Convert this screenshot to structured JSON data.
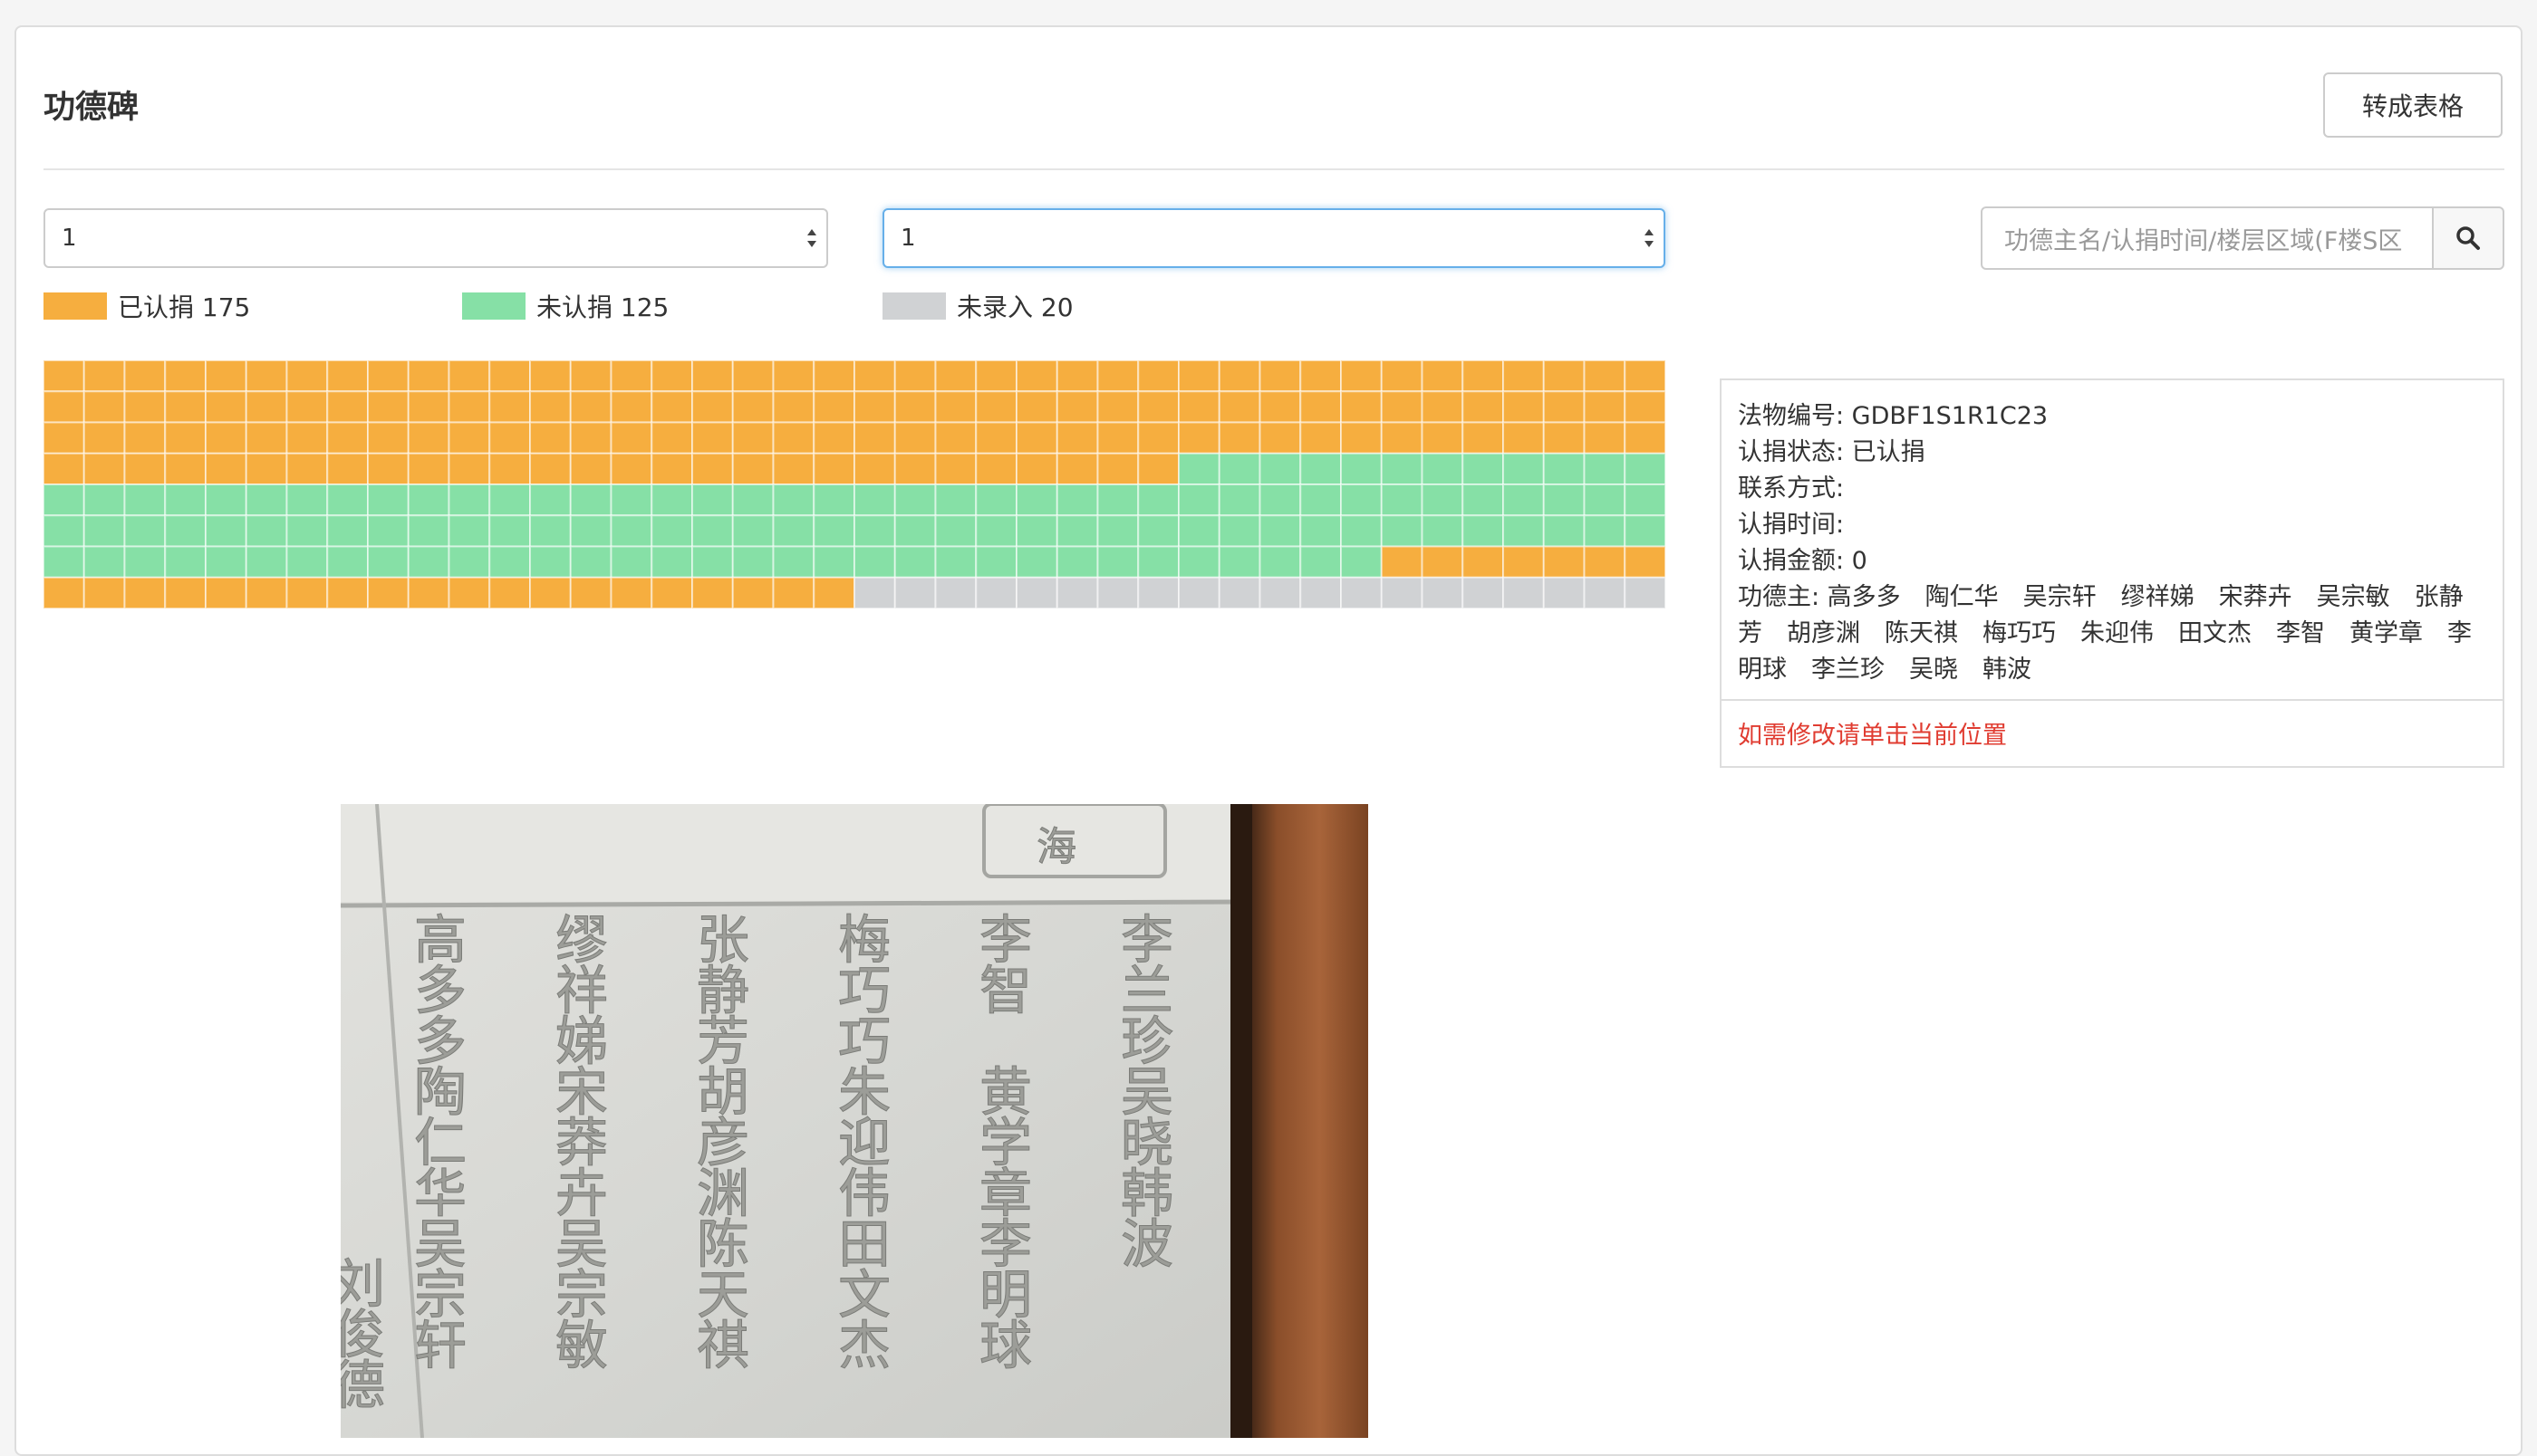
{
  "page": {
    "title": "功德碑",
    "convert_button": "转成表格"
  },
  "filters": {
    "select_one_value": "1",
    "select_two_value": "1",
    "search_placeholder": "功德主名/认捐时间/楼层区域(F楼S区"
  },
  "legend": {
    "donated_label": "已认捐 175",
    "undonated_label": "未认捐 125",
    "unentered_label": "未录入 20"
  },
  "colors": {
    "donated": "#f6ae3f",
    "undonated": "#86e0a6",
    "unentered": "#d0d2d4",
    "link": "#e03c31"
  },
  "grid": {
    "columns": 40,
    "rows": [
      {
        "segments": [
          {
            "status": "donated",
            "count": 40
          }
        ]
      },
      {
        "segments": [
          {
            "status": "donated",
            "count": 40
          }
        ]
      },
      {
        "segments": [
          {
            "status": "donated",
            "count": 40
          }
        ]
      },
      {
        "segments": [
          {
            "status": "donated",
            "count": 28
          },
          {
            "status": "undonated",
            "count": 12
          }
        ]
      },
      {
        "segments": [
          {
            "status": "undonated",
            "count": 40
          }
        ]
      },
      {
        "segments": [
          {
            "status": "undonated",
            "count": 40
          }
        ]
      },
      {
        "segments": [
          {
            "status": "undonated",
            "count": 33
          },
          {
            "status": "donated",
            "count": 7
          }
        ]
      },
      {
        "segments": [
          {
            "status": "donated",
            "count": 20
          },
          {
            "status": "unentered",
            "count": 20
          }
        ]
      }
    ]
  },
  "info": {
    "code": "法物编号: GDBF1S1R1C23",
    "status": "认捐状态: 已认捐",
    "contact": "联系方式:",
    "time": "认捐时间:",
    "amount": "认捐金额: 0",
    "donors": "功德主: 高多多　陶仁华　吴宗轩　缪祥娣　宋莽卉　吴宗敏　张静芳　胡彦渊　陈天祺　梅巧巧　朱迎伟　田文杰　李智　黄学章　李明球　李兰珍　吴晓　韩波",
    "edit_link": "如需修改请单击当前位置"
  },
  "photo": {
    "columns": [
      [
        "李",
        "兰",
        "珍",
        "吴",
        "晓",
        "韩",
        "波"
      ],
      [
        "李",
        "智",
        "",
        "黄",
        "学",
        "章",
        "李",
        "明",
        "球"
      ],
      [
        "梅",
        "巧",
        "巧",
        "朱",
        "迎",
        "伟",
        "田",
        "文",
        "杰"
      ],
      [
        "张",
        "静",
        "芳",
        "胡",
        "彦",
        "渊",
        "陈",
        "天",
        "祺"
      ],
      [
        "缪",
        "祥",
        "娣",
        "宋",
        "莽",
        "卉",
        "吴",
        "宗",
        "敏"
      ],
      [
        "高",
        "多",
        "多",
        "陶",
        "仁",
        "华",
        "吴",
        "宗",
        "轩"
      ]
    ],
    "left_partial": [
      "刘",
      "俊",
      "德"
    ],
    "stamp": "海"
  }
}
